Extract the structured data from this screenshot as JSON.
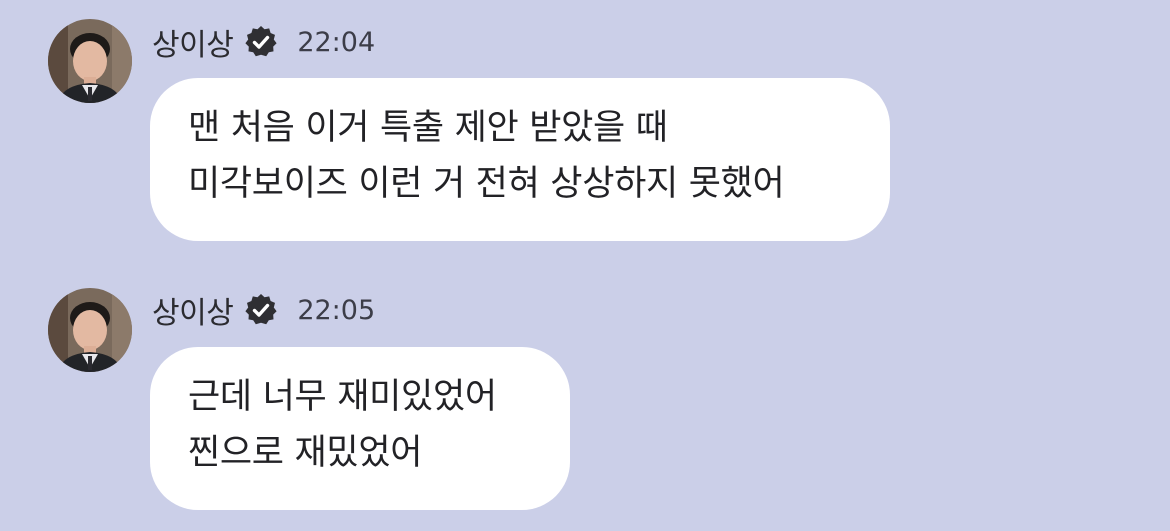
{
  "messages": [
    {
      "sender": "상이상",
      "time": "22:04",
      "lines": [
        "맨 처음 이거 특출 제안 받았을 때",
        "미각보이즈 이런 거 전혀 상상하지 못했어"
      ]
    },
    {
      "sender": "상이상",
      "time": "22:05",
      "lines": [
        "근데 너무 재미있었어",
        "찐으로 재밌었어"
      ]
    }
  ],
  "colors": {
    "background": "#cbcfe8",
    "bubble": "#ffffff",
    "verified_badge": "#2f2f33"
  },
  "icons": {
    "verified": "verified-badge-icon",
    "avatar": "profile-photo"
  }
}
